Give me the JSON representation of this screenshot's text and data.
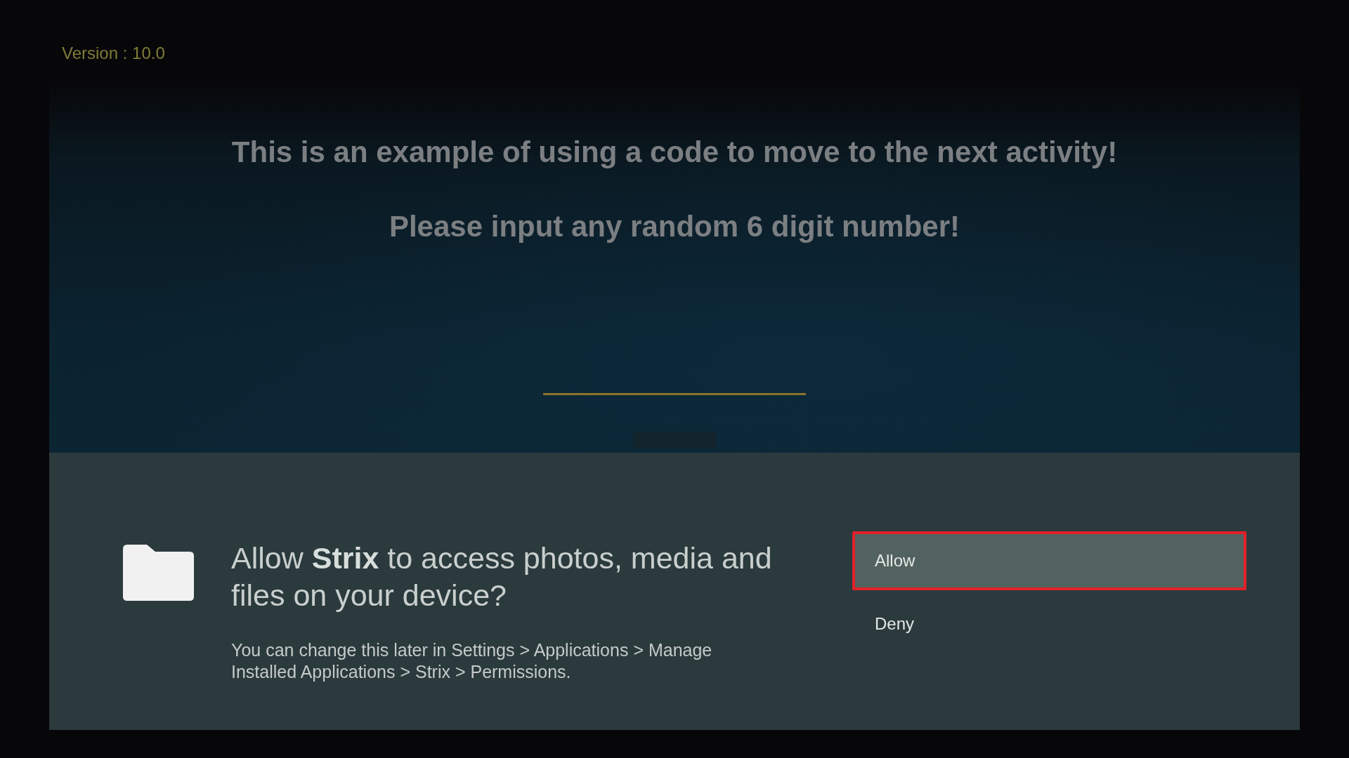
{
  "version_label": "Version : 10.0",
  "screen": {
    "headline": "This is an example of using a code to move to the next activity!",
    "instruction": "Please input any random 6 digit number!"
  },
  "permission_dialog": {
    "title": "Allow **Strix** to access photos, media and files on your device?",
    "message": "You can change this later in Settings > Applications > Manage Installed Applications > Strix > Permissions.",
    "buttons": [
      {
        "label": "Allow",
        "selected": true
      },
      {
        "label": "Deny",
        "selected": false
      }
    ]
  }
}
